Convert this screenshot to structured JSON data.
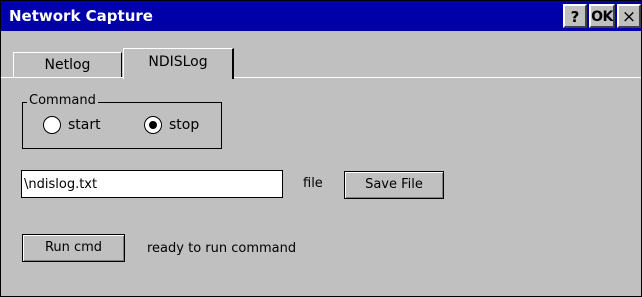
{
  "window": {
    "title": "Network Capture",
    "help_label": "?",
    "ok_label": "OK",
    "close_label": "×"
  },
  "tabs": [
    {
      "label": "Netlog",
      "selected": false
    },
    {
      "label": "NDISLog",
      "selected": true
    }
  ],
  "command_group": {
    "legend": "Command",
    "options": [
      {
        "label": "start",
        "checked": false
      },
      {
        "label": "stop",
        "checked": true
      }
    ]
  },
  "file": {
    "value": "\\ndislog.txt",
    "label": "file",
    "save_label": "Save File"
  },
  "run": {
    "button_label": "Run cmd",
    "status": "ready to run command"
  },
  "colors": {
    "titlebar": "#0000a8",
    "face": "#c0c0c0"
  }
}
